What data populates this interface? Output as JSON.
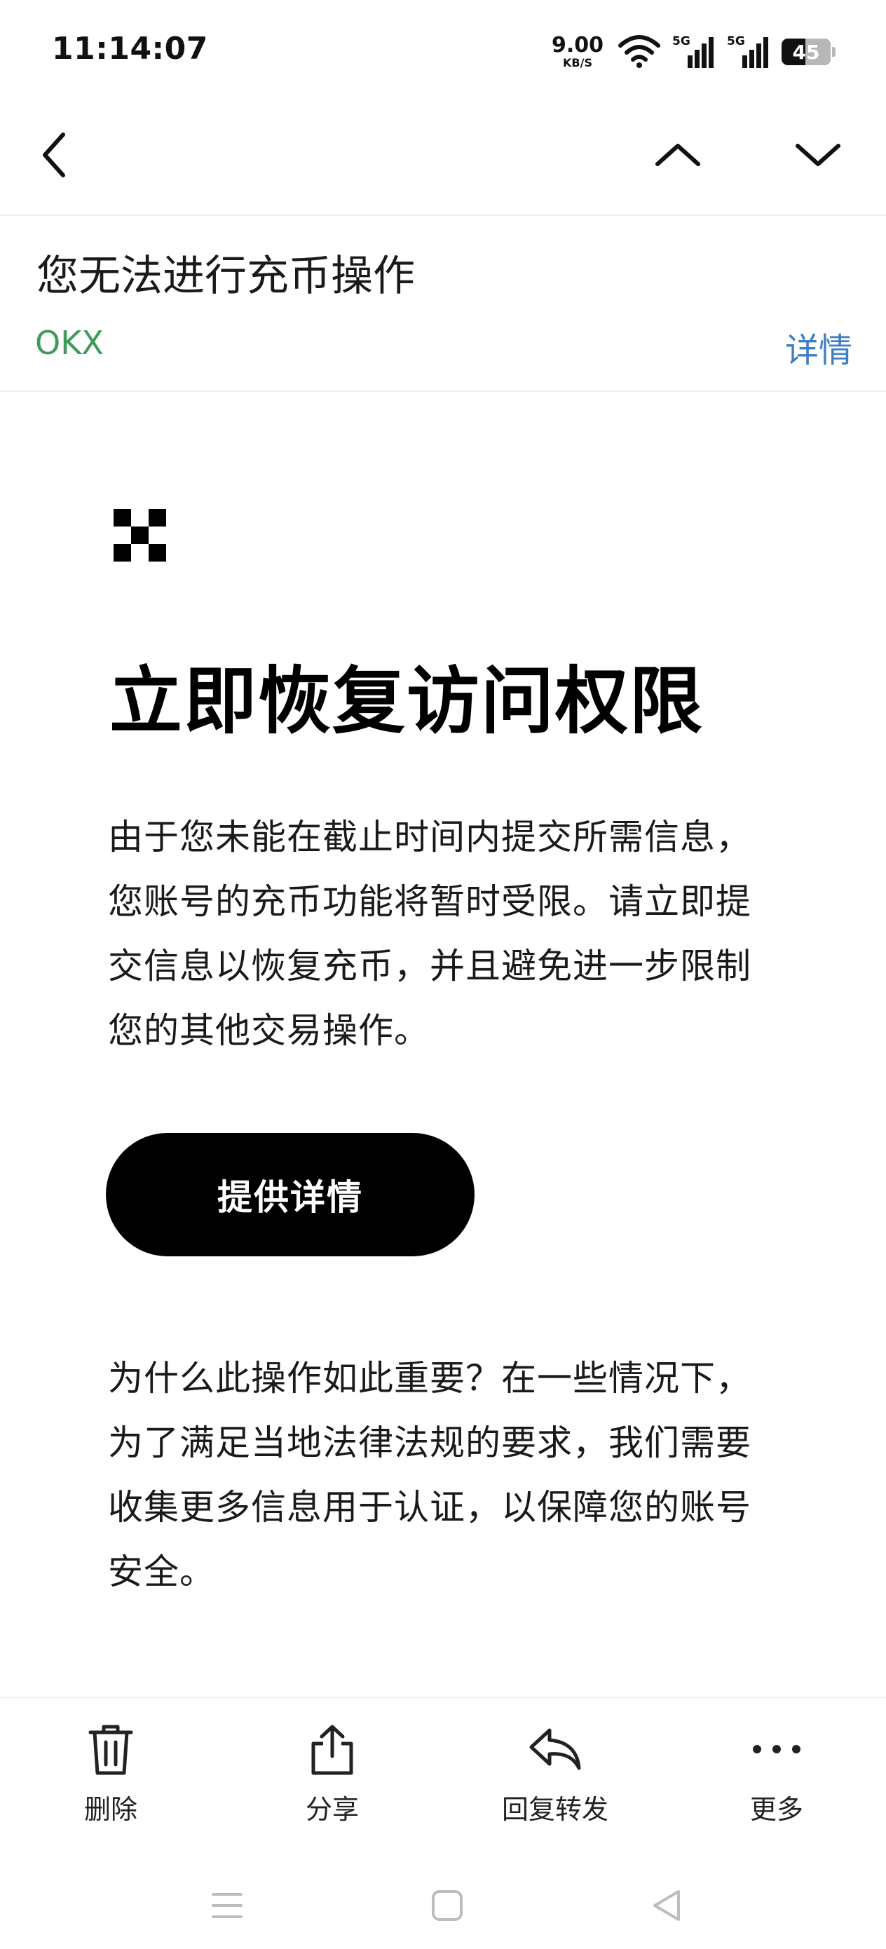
{
  "status_bar": {
    "time": "11:14:07",
    "net_speed_value": "9.00",
    "net_speed_unit": "KB/S",
    "sim1_label": "5G",
    "sim2_label": "5G",
    "battery": "45",
    "icons": [
      "wifi-icon",
      "signal-icon",
      "signal-icon",
      "battery-icon"
    ]
  },
  "toolbar": {
    "back_icon": "chevron-left-icon",
    "prev_icon": "chevron-up-icon",
    "next_icon": "chevron-down-icon"
  },
  "email": {
    "subject": "您无法进行充币操作",
    "sender": "OKX",
    "details_link": "详情",
    "heading": "立即恢复访问权限",
    "paragraph_1": "由于您未能在截止时间内提交所需信息，您账号的充币功能将暂时受限。请立即提交信息以恢复充币，并且避免进一步限制您的其他交易操作。",
    "cta_label": "提供详情",
    "paragraph_2": "为什么此操作如此重要？在一些情况下，为了满足当地法律法规的要求，我们需要收集更多信息用于认证，以保障您的账号安全。"
  },
  "actions": [
    {
      "label": "删除",
      "icon": "trash-icon"
    },
    {
      "label": "分享",
      "icon": "share-icon"
    },
    {
      "label": "回复转发",
      "icon": "reply-icon"
    },
    {
      "label": "更多",
      "icon": "more-icon"
    }
  ],
  "system_nav": {
    "icons": [
      "menu-icon",
      "home-icon",
      "back-triangle-icon"
    ]
  },
  "colors": {
    "sender_green": "#3f9a5c",
    "link_blue": "#3f7fc1",
    "cta_background": "#000000"
  }
}
